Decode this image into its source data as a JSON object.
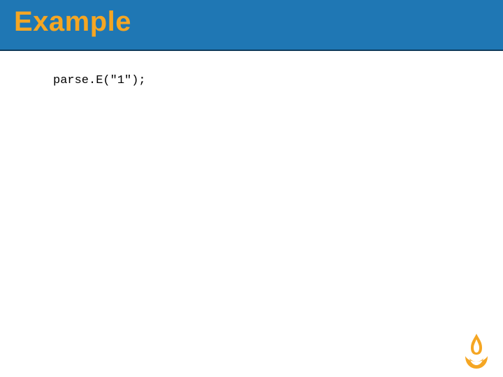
{
  "header": {
    "title": "Example"
  },
  "body": {
    "code": "parse.E(\"1\");"
  },
  "branding": {
    "logo_name": "flame-logo",
    "logo_color": "#f5a623"
  }
}
